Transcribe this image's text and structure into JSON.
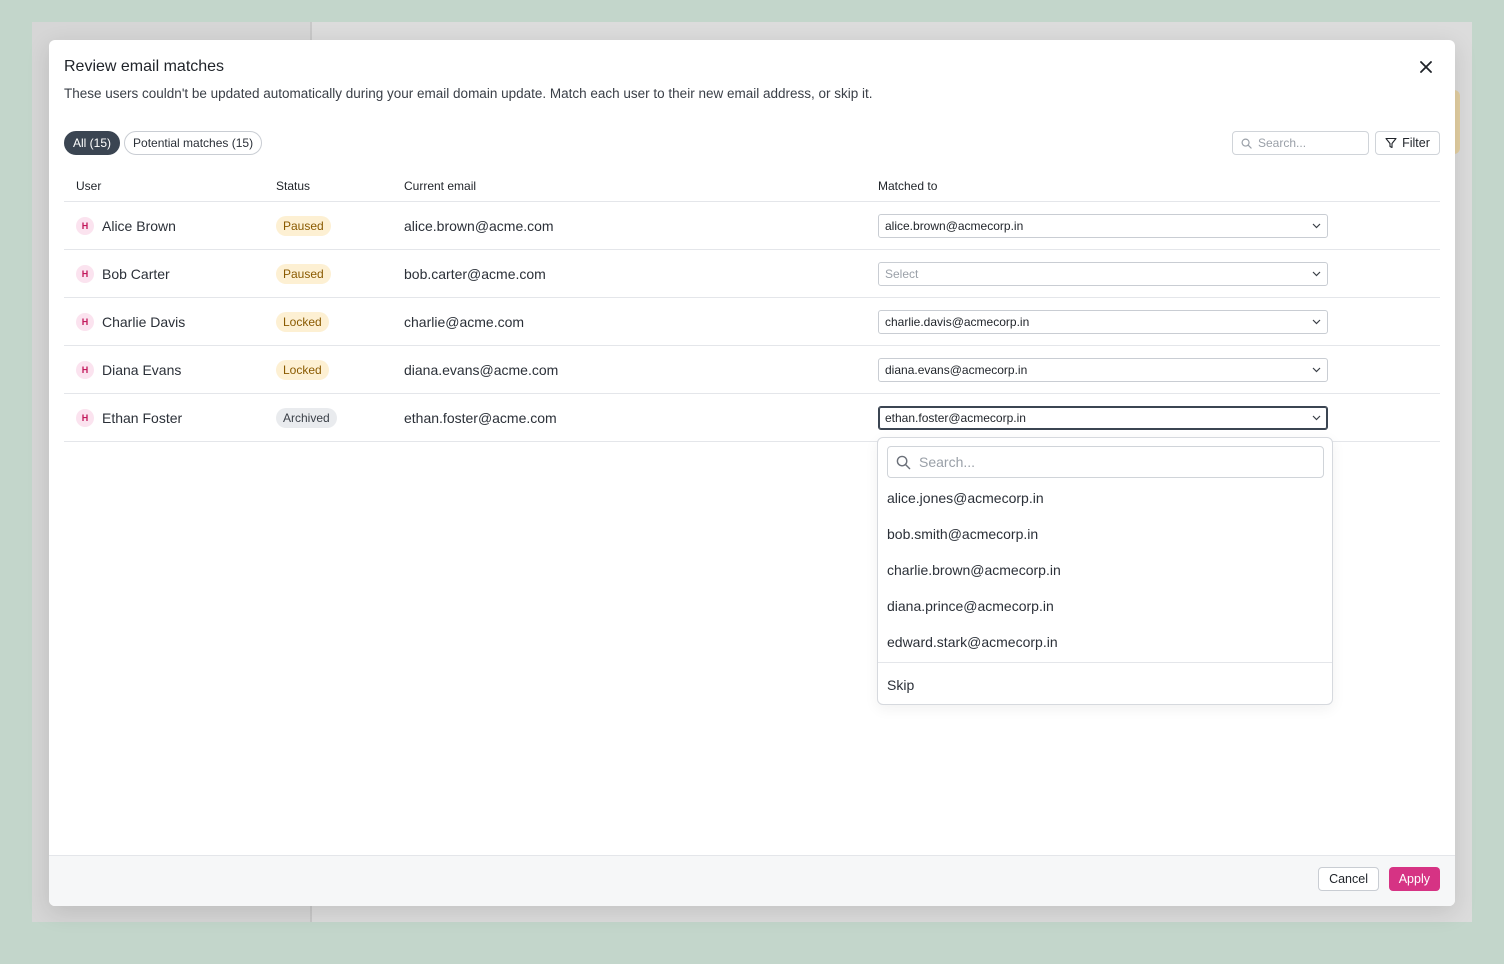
{
  "modal": {
    "title": "Review email matches",
    "subtitle": "These users couldn't be updated automatically during your email domain update. Match each user to their new email address, or skip it."
  },
  "tabs": [
    {
      "label": "All (15)",
      "active": true
    },
    {
      "label": "Potential matches (15)",
      "active": false
    }
  ],
  "search": {
    "placeholder": "Search..."
  },
  "filter": {
    "label": "Filter"
  },
  "table": {
    "columns": [
      "User",
      "Status",
      "Current email",
      "Matched to"
    ],
    "rows": [
      {
        "initial": "H",
        "user": "Alice Brown",
        "status": "Paused",
        "status_type": "warn",
        "current_email": "alice.brown@acme.com",
        "matched_to": "alice.brown@acmecorp.in"
      },
      {
        "initial": "H",
        "user": "Bob Carter",
        "status": "Paused",
        "status_type": "warn",
        "current_email": "bob.carter@acme.com",
        "matched_to": "Select"
      },
      {
        "initial": "H",
        "user": "Charlie Davis",
        "status": "Locked",
        "status_type": "warn",
        "current_email": "charlie@acme.com",
        "matched_to": "charlie.davis@acmecorp.in"
      },
      {
        "initial": "H",
        "user": "Diana Evans",
        "status": "Locked",
        "status_type": "warn",
        "current_email": "diana.evans@acme.com",
        "matched_to": "diana.evans@acmecorp.in"
      },
      {
        "initial": "H",
        "user": "Ethan Foster",
        "status": "Archived",
        "status_type": "gray",
        "current_email": "ethan.foster@acme.com",
        "matched_to": "ethan.foster@acmecorp.in"
      }
    ]
  },
  "dropdown": {
    "search_placeholder": "Search...",
    "options": [
      "alice.jones@acmecorp.in",
      "bob.smith@acmecorp.in",
      "charlie.brown@acmecorp.in",
      "diana.prince@acmecorp.in",
      "edward.stark@acmecorp.in"
    ],
    "skip_label": "Skip"
  },
  "footer": {
    "cancel_label": "Cancel",
    "apply_label": "Apply"
  },
  "colors": {
    "accent": "#d63384",
    "active_pill": "#3b4552",
    "warn_badge": "#fdf0d3",
    "gray_badge": "#e9ebee"
  },
  "icons": {
    "close": "close-icon",
    "search": "search-icon",
    "filter": "filter-icon",
    "chevron": "chevron-down-icon"
  }
}
